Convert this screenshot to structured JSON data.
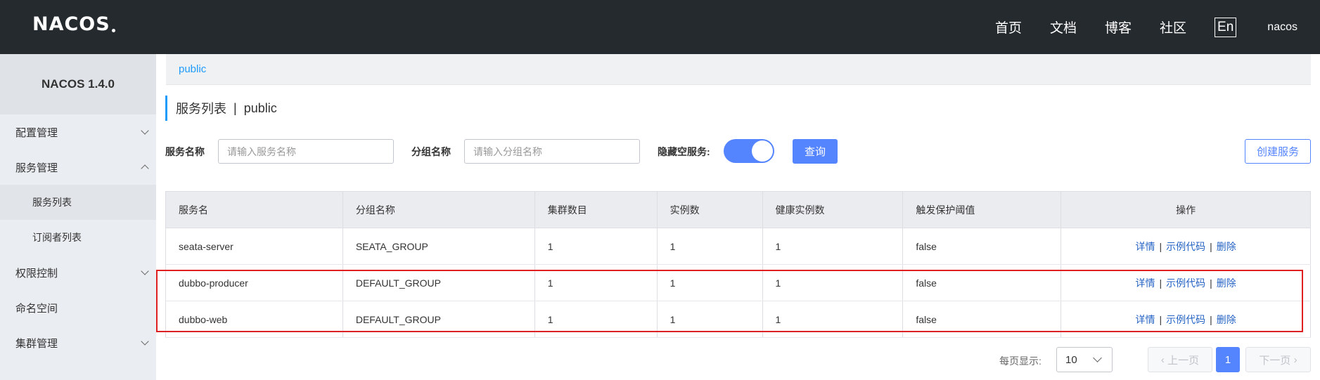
{
  "header": {
    "logo": "NACOS",
    "nav": [
      "首页",
      "文档",
      "博客",
      "社区"
    ],
    "lang": "En",
    "user": "nacos"
  },
  "sidebar": {
    "title": "NACOS 1.4.0",
    "items": [
      {
        "label": "配置管理"
      },
      {
        "label": "服务管理"
      },
      {
        "label": "服务列表"
      },
      {
        "label": "订阅者列表"
      },
      {
        "label": "权限控制"
      },
      {
        "label": "命名空间"
      },
      {
        "label": "集群管理"
      }
    ]
  },
  "breadcrumb": "public",
  "page": {
    "title": "服务列表",
    "sep": "|",
    "namespace": "public"
  },
  "filters": {
    "service_name_label": "服务名称",
    "service_name_placeholder": "请输入服务名称",
    "group_name_label": "分组名称",
    "group_name_placeholder": "请输入分组名称",
    "hide_empty_label": "隐藏空服务:",
    "hide_empty_on": true,
    "query_button": "查询",
    "create_button": "创建服务"
  },
  "table": {
    "columns": [
      "服务名",
      "分组名称",
      "集群数目",
      "实例数",
      "健康实例数",
      "触发保护阈值",
      "操作"
    ],
    "rows": [
      [
        "seata-server",
        "SEATA_GROUP",
        "1",
        "1",
        "1",
        "false"
      ],
      [
        "dubbo-producer",
        "DEFAULT_GROUP",
        "1",
        "1",
        "1",
        "false"
      ],
      [
        "dubbo-web",
        "DEFAULT_GROUP",
        "1",
        "1",
        "1",
        "false"
      ]
    ],
    "ops": {
      "detail": "详情",
      "sample": "示例代码",
      "delete": "删除",
      "sep": "|"
    }
  },
  "pagination": {
    "page_size_label": "每页显示:",
    "page_size": "10",
    "prev": "上一页",
    "current": "1",
    "next": "下一页"
  },
  "colors": {
    "topbar": "#252a2f",
    "primary": "#5584ff",
    "link": "#2563c4",
    "highlight": "#e02020"
  }
}
